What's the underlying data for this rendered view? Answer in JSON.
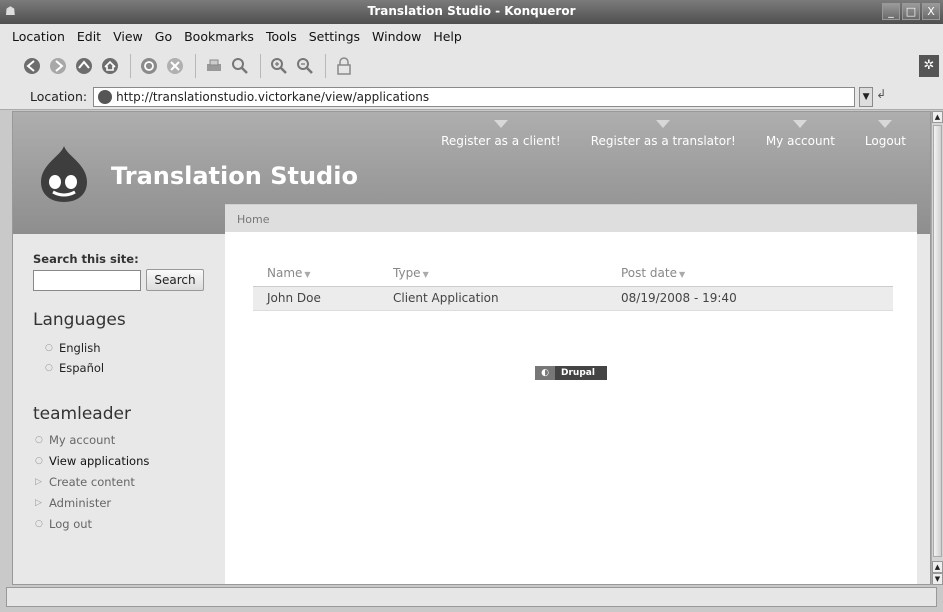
{
  "window": {
    "title": "Translation Studio - Konqueror",
    "buttons": [
      "_",
      "□",
      "X"
    ]
  },
  "menubar": {
    "items": [
      "Location",
      "Edit",
      "View",
      "Go",
      "Bookmarks",
      "Tools",
      "Settings",
      "Window",
      "Help"
    ]
  },
  "locationbar": {
    "label": "Location:",
    "url": "http://translationstudio.victorkane/view/applications"
  },
  "site": {
    "name": "Translation Studio",
    "primary_links": [
      "Register as a client!",
      "Register as a translator!",
      "My account",
      "Logout"
    ],
    "breadcrumb": "Home"
  },
  "sidebar": {
    "search_label": "Search this site:",
    "search_button": "Search",
    "languages_title": "Languages",
    "languages": [
      "English",
      "Español"
    ],
    "user_block_title": "teamleader",
    "user_menu": [
      "My account",
      "View applications",
      "Create content",
      "Administer",
      "Log out"
    ]
  },
  "table": {
    "headers": [
      "Name",
      "Type",
      "Post date"
    ],
    "rows": [
      [
        "John Doe",
        "Client Application",
        "08/19/2008 - 19:40"
      ]
    ]
  },
  "footer": {
    "badge_text": "Drupal"
  }
}
